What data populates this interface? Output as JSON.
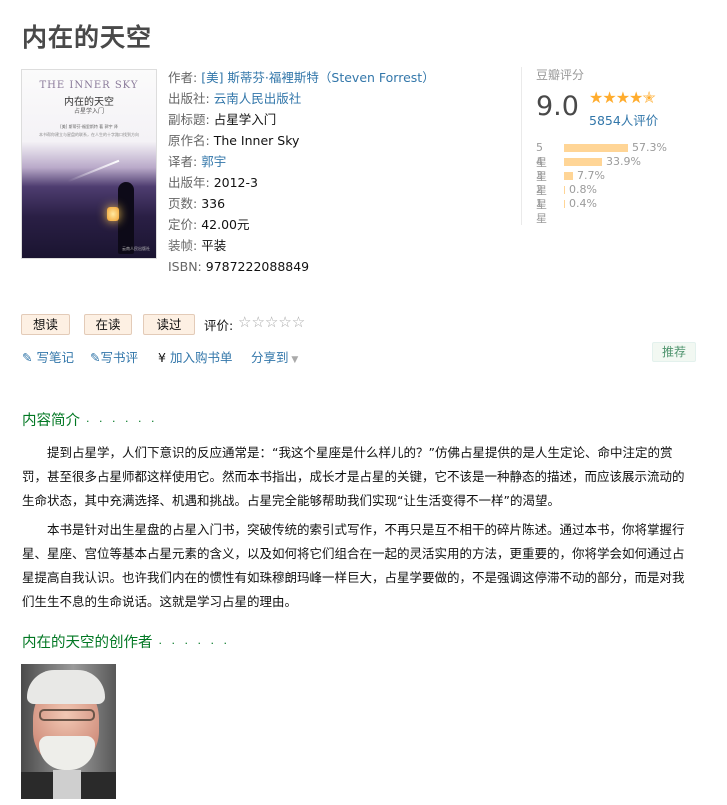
{
  "page": {
    "title": "内在的天空"
  },
  "cover": {
    "title_en": "THE INNER SKY",
    "title_zh": "内在的天空",
    "subtitle": "占星学入门",
    "author_line": "[美] 斯蒂芬·福里斯特 著  郭宇 译",
    "description": "本书帮你建立与星盘的联系，在人生的十字路口找到方向",
    "publisher_mark": "云南人民出版社"
  },
  "info": {
    "author_label": "作者:",
    "author_value": "[美] 斯蒂芬·福裡斯特（Steven Forrest）",
    "publisher_label": "出版社:",
    "publisher_value": "云南人民出版社",
    "subtitle_label": "副标题:",
    "subtitle_value": "占星学入门",
    "original_label": "原作名:",
    "original_value": "The Inner Sky",
    "translator_label": "译者:",
    "translator_value": "郭宇",
    "year_label": "出版年:",
    "year_value": "2012-3",
    "pages_label": "页数:",
    "pages_value": "336",
    "price_label": "定价:",
    "price_value": "42.00元",
    "binding_label": "装帧:",
    "binding_value": "平装",
    "isbn_label": "ISBN:",
    "isbn_value": "9787222088849"
  },
  "rating": {
    "label": "豆瓣评分",
    "score": "9.0",
    "stars": "★★★★",
    "count": "5854人评价",
    "distribution": [
      {
        "label": "5星",
        "percent": 57.3,
        "text": "57.3%"
      },
      {
        "label": "4星",
        "percent": 33.9,
        "text": "33.9%"
      },
      {
        "label": "3星",
        "percent": 7.7,
        "text": "7.7%"
      },
      {
        "label": "2星",
        "percent": 0.8,
        "text": "0.8%"
      },
      {
        "label": "1星",
        "percent": 0.4,
        "text": "0.4%"
      }
    ],
    "colors": {
      "star": "#ffac2d",
      "bar": "#ffd596"
    }
  },
  "actions": {
    "want": "想读",
    "doing": "在读",
    "done": "读过",
    "rate_label": "评价:",
    "rate_stars": "☆☆☆☆☆",
    "write_note": "写笔记",
    "write_review": "写书评",
    "add_cart": "加入购书单",
    "share": "分享到",
    "recommend": "推荐"
  },
  "intro": {
    "title": "内容简介",
    "dots": "· · · · · ·",
    "p1": "提到占星学，人们下意识的反应通常是：“我这个星座是什么样儿的？”仿佛占星提供的是人生定论、命中注定的赏罚，甚至很多占星师都这样使用它。然而本书指出，成长才是占星的关键，它不该是一种静态的描述，而应该展示流动的生命状态，其中充满选择、机遇和挑战。占星完全能够帮助我们实现“让生活变得不一样”的渴望。",
    "p2": "本书是针对出生星盘的占星入门书，突破传统的索引式写作，不再只是互不相干的碎片陈述。通过本书，你将掌握行星、星座、宫位等基本占星元素的含义，以及如何将它们组合在一起的灵活实用的方法，更重要的，你将学会如何通过占星提高自我认识。也许我们内在的惯性有如珠穆朗玛峰一样巨大，占星学要做的，不是强调这停滞不动的部分，而是对我们生生不息的生命说话。这就是学习占星的理由。"
  },
  "author_section": {
    "title": "内在的天空的创作者",
    "dots": "· · · · · ·"
  }
}
